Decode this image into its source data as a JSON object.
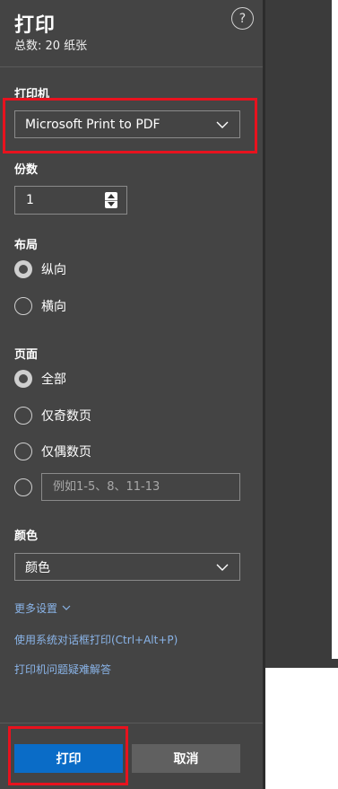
{
  "header": {
    "title": "打印",
    "subtitle": "总数: 20 纸张",
    "help_icon_char": "?"
  },
  "printer": {
    "label": "打印机",
    "selected": "Microsoft Print to PDF"
  },
  "copies": {
    "label": "份数",
    "value": "1"
  },
  "layout": {
    "label": "布局",
    "options": [
      {
        "label": "纵向",
        "checked": true
      },
      {
        "label": "横向",
        "checked": false
      }
    ]
  },
  "pages": {
    "label": "页面",
    "options": [
      {
        "label": "全部",
        "checked": true
      },
      {
        "label": "仅奇数页",
        "checked": false
      },
      {
        "label": "仅偶数页",
        "checked": false
      }
    ],
    "custom_placeholder": "例如1-5、8、11-13"
  },
  "color": {
    "label": "颜色",
    "selected": "颜色"
  },
  "links": {
    "more_settings": "更多设置",
    "system_dialog": "使用系统对话框打印(Ctrl+Alt+P)",
    "troubleshoot": "打印机问题疑难解答"
  },
  "buttons": {
    "print": "打印",
    "cancel": "取消"
  },
  "colors": {
    "panel_bg": "#444444",
    "accent": "#0a6cc7",
    "link": "#8ab4e8",
    "highlight_frame": "#e8121e"
  }
}
